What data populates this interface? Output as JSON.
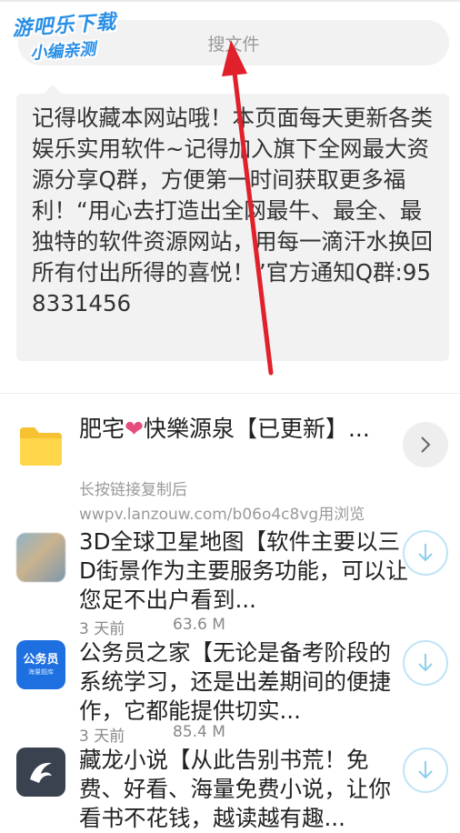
{
  "watermark": {
    "line1": "游吧乐下载",
    "line2": "小编亲测"
  },
  "search": {
    "placeholder": "搜文件"
  },
  "notice": {
    "text": "记得收藏本网站哦！本页面每天更新各类娱乐实用软件~记得加入旗下全网最大资源分享Q群，方便第一时间获取更多福利！“用心去打造出全网最牛、最全、最独特的软件资源网站，用每一滴汗水换回所有付出所得的喜悦！”官方通知Q群:958331456"
  },
  "folder": {
    "title_before": "肥宅",
    "heart": "❤",
    "title_after": "快樂源泉【已更新】...",
    "hint": "长按链接复制后",
    "url": "wwpv.lanzouw.com/b06o4c8vg用浏览"
  },
  "files": [
    {
      "title": "3D全球卫星地图【软件主要以三D街景作为主要服务功能，可以让您足不出户看到...",
      "time": "3 天前",
      "size": "63.6 M",
      "icon": "map-thumbnail"
    },
    {
      "title": "公务员之家【无论是备考阶段的系统学习，还是出差期间的便捷作，它都能提供切实...",
      "time": "3 天前",
      "size": "85.4 M",
      "icon": "civil-servant-app-icon",
      "icon_text": "公务员",
      "icon_subtext": "海量题库"
    },
    {
      "title": "藏龙小说【从此告别书荒！免费、好看、海量免费小说，让你看书不花钱，越读越有趣...",
      "time": "",
      "size": "",
      "icon": "novel-app-icon"
    }
  ],
  "colors": {
    "accent": "#2a8fe6",
    "download_border": "#bfe3f7",
    "download_arrow": "#8ccfee",
    "arrow_annotation": "#e0202a"
  }
}
